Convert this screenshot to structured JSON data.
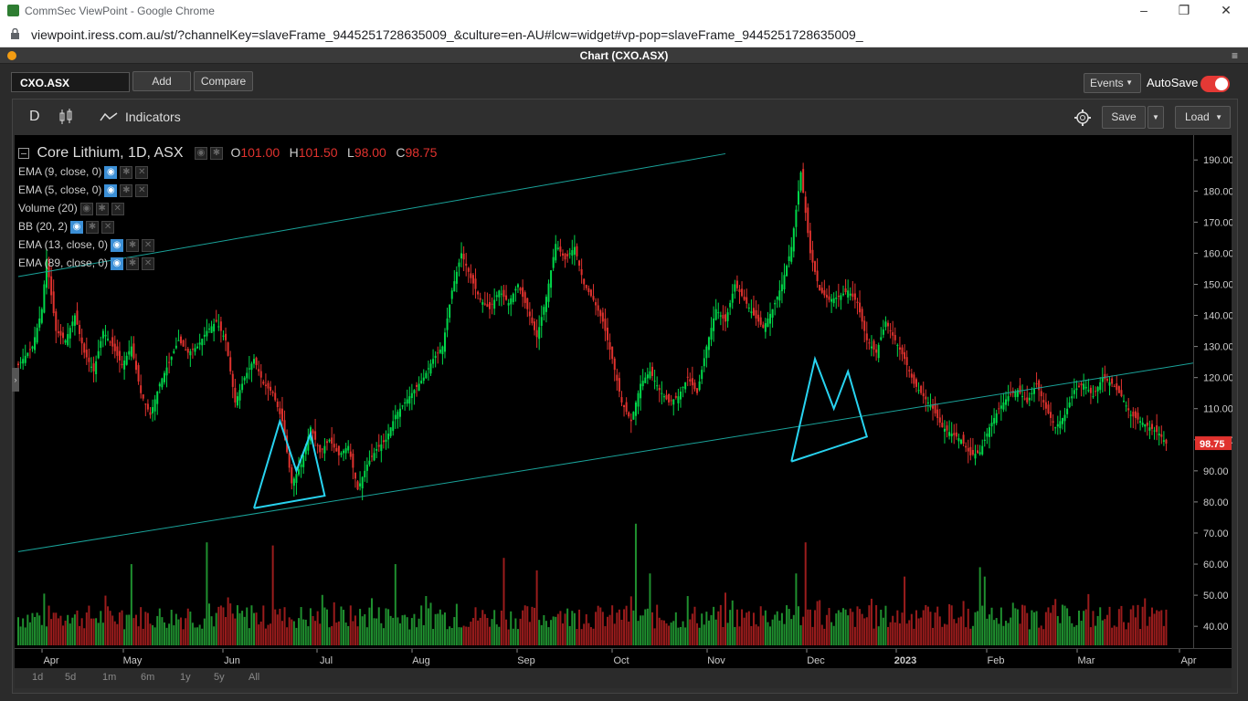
{
  "window": {
    "title": "CommSec ViewPoint - Google Chrome",
    "minimize": "–",
    "restore": "❐",
    "close": "✕"
  },
  "address": {
    "url": "viewpoint.iress.com.au/st/?channelKey=slaveFrame_9445251728635009_&culture=en-AU#lcw=widget#vp-pop=slaveFrame_9445251728635009_"
  },
  "app": {
    "title": "Chart (CXO.ASX)"
  },
  "toolbar": {
    "symbol": "CXO.ASX",
    "add": "Add",
    "compare": "Compare",
    "events": "Events",
    "autosave": "AutoSave",
    "autosave_on": true
  },
  "chart_toolbar": {
    "interval": "D",
    "indicators": "Indicators",
    "save": "Save",
    "load": "Load"
  },
  "legend": {
    "name": "Core Lithium, 1D, ASX",
    "o_label": "O",
    "o": "101.00",
    "h_label": "H",
    "h": "101.50",
    "l_label": "L",
    "l": "98.00",
    "c_label": "C",
    "c": "98.75",
    "studies": [
      "EMA (9, close, 0)",
      "EMA (5, close, 0)",
      "Volume (20)",
      "BB (20, 2)",
      "EMA (13, close, 0)",
      "EMA (89, close, 0)"
    ]
  },
  "periods": [
    "1d",
    "5d",
    "1m",
    "6m",
    "1y",
    "5y",
    "All"
  ],
  "colors": {
    "up": "#00d84a",
    "down": "#e0322e",
    "trend": "#1aa39a",
    "pattern": "#28d3f0",
    "price_tag": "#e0322e"
  },
  "chart_data": {
    "type": "candlestick",
    "title": "Core Lithium, 1D, ASX",
    "ylim": [
      33,
      198
    ],
    "yticks": [
      40,
      50,
      60,
      70,
      80,
      90,
      100,
      110,
      120,
      130,
      140,
      150,
      160,
      170,
      180,
      190
    ],
    "ytick_labels": [
      "40.00",
      "50.00",
      "60.00",
      "70.00",
      "80.00",
      "90.00",
      "100.00",
      "110.00",
      "120.00",
      "130.00",
      "140.00",
      "150.00",
      "160.00",
      "170.00",
      "180.00",
      "190.00"
    ],
    "xtick_labels": [
      "Apr",
      "May",
      "Jun",
      "Jul",
      "Aug",
      "Sep",
      "Oct",
      "Nov",
      "Dec",
      "2023",
      "Feb",
      "Mar",
      "Apr"
    ],
    "last_price": "98.75",
    "close_path": [
      [
        0,
        124
      ],
      [
        6,
        130
      ],
      [
        10,
        142
      ],
      [
        12,
        158
      ],
      [
        16,
        135
      ],
      [
        20,
        132
      ],
      [
        24,
        140
      ],
      [
        28,
        128
      ],
      [
        32,
        122
      ],
      [
        36,
        135
      ],
      [
        40,
        130
      ],
      [
        44,
        124
      ],
      [
        48,
        130
      ],
      [
        52,
        115
      ],
      [
        56,
        108
      ],
      [
        60,
        118
      ],
      [
        64,
        125
      ],
      [
        68,
        132
      ],
      [
        72,
        128
      ],
      [
        76,
        130
      ],
      [
        80,
        135
      ],
      [
        84,
        138
      ],
      [
        88,
        132
      ],
      [
        92,
        112
      ],
      [
        96,
        120
      ],
      [
        100,
        126
      ],
      [
        104,
        118
      ],
      [
        108,
        115
      ],
      [
        112,
        106
      ],
      [
        116,
        86
      ],
      [
        120,
        92
      ],
      [
        124,
        104
      ],
      [
        128,
        96
      ],
      [
        132,
        100
      ],
      [
        136,
        95
      ],
      [
        140,
        98
      ],
      [
        144,
        84
      ],
      [
        148,
        92
      ],
      [
        152,
        97
      ],
      [
        156,
        100
      ],
      [
        160,
        108
      ],
      [
        164,
        112
      ],
      [
        168,
        116
      ],
      [
        172,
        120
      ],
      [
        176,
        126
      ],
      [
        180,
        130
      ],
      [
        184,
        148
      ],
      [
        188,
        160
      ],
      [
        192,
        152
      ],
      [
        196,
        145
      ],
      [
        200,
        142
      ],
      [
        204,
        148
      ],
      [
        208,
        144
      ],
      [
        212,
        150
      ],
      [
        216,
        142
      ],
      [
        220,
        133
      ],
      [
        224,
        146
      ],
      [
        228,
        163
      ],
      [
        232,
        158
      ],
      [
        236,
        162
      ],
      [
        240,
        150
      ],
      [
        244,
        145
      ],
      [
        248,
        138
      ],
      [
        252,
        126
      ],
      [
        256,
        112
      ],
      [
        260,
        106
      ],
      [
        264,
        118
      ],
      [
        268,
        122
      ],
      [
        272,
        116
      ],
      [
        276,
        112
      ],
      [
        280,
        114
      ],
      [
        284,
        120
      ],
      [
        288,
        115
      ],
      [
        292,
        130
      ],
      [
        296,
        142
      ],
      [
        300,
        138
      ],
      [
        304,
        150
      ],
      [
        308,
        145
      ],
      [
        312,
        140
      ],
      [
        316,
        136
      ],
      [
        320,
        142
      ],
      [
        324,
        150
      ],
      [
        328,
        162
      ],
      [
        332,
        186
      ],
      [
        336,
        160
      ],
      [
        340,
        148
      ],
      [
        344,
        145
      ],
      [
        348,
        146
      ],
      [
        352,
        148
      ],
      [
        356,
        144
      ],
      [
        360,
        132
      ],
      [
        364,
        128
      ],
      [
        368,
        138
      ],
      [
        372,
        132
      ],
      [
        376,
        126
      ],
      [
        380,
        118
      ],
      [
        384,
        114
      ],
      [
        388,
        110
      ],
      [
        392,
        104
      ],
      [
        396,
        102
      ],
      [
        400,
        100
      ],
      [
        404,
        95
      ],
      [
        408,
        96
      ],
      [
        412,
        104
      ],
      [
        416,
        110
      ],
      [
        420,
        114
      ],
      [
        424,
        116
      ],
      [
        428,
        112
      ],
      [
        432,
        118
      ],
      [
        436,
        110
      ],
      [
        440,
        104
      ],
      [
        444,
        108
      ],
      [
        448,
        116
      ],
      [
        452,
        118
      ],
      [
        456,
        114
      ],
      [
        460,
        120
      ],
      [
        464,
        118
      ],
      [
        468,
        114
      ],
      [
        472,
        108
      ],
      [
        476,
        106
      ],
      [
        480,
        104
      ],
      [
        484,
        102
      ],
      [
        487,
        98.75
      ]
    ],
    "volume_scale": "same axis as price (bars drawn from 36 upward)",
    "volume_spikes": [
      [
        48,
        60
      ],
      [
        80,
        67
      ],
      [
        108,
        66
      ],
      [
        160,
        60
      ],
      [
        206,
        62
      ],
      [
        220,
        58
      ],
      [
        262,
        73
      ],
      [
        268,
        57
      ],
      [
        330,
        57
      ],
      [
        334,
        67
      ],
      [
        376,
        56
      ],
      [
        408,
        59
      ],
      [
        410,
        56
      ],
      [
        478,
        49
      ]
    ],
    "trendlines": [
      {
        "from": [
          0,
          152.5
        ],
        "to": [
          300,
          192
        ]
      },
      {
        "from": [
          0,
          64
        ],
        "to": [
          530,
          128.5
        ]
      }
    ],
    "patterns": [
      {
        "points": [
          [
            100,
            78
          ],
          [
            111,
            106
          ],
          [
            118,
            90
          ],
          [
            124,
            102
          ],
          [
            130,
            82
          ],
          [
            100,
            78
          ]
        ]
      },
      {
        "points": [
          [
            328,
            93
          ],
          [
            338,
            126
          ],
          [
            346,
            110
          ],
          [
            352,
            122
          ],
          [
            360,
            101
          ],
          [
            328,
            93
          ]
        ]
      }
    ]
  }
}
